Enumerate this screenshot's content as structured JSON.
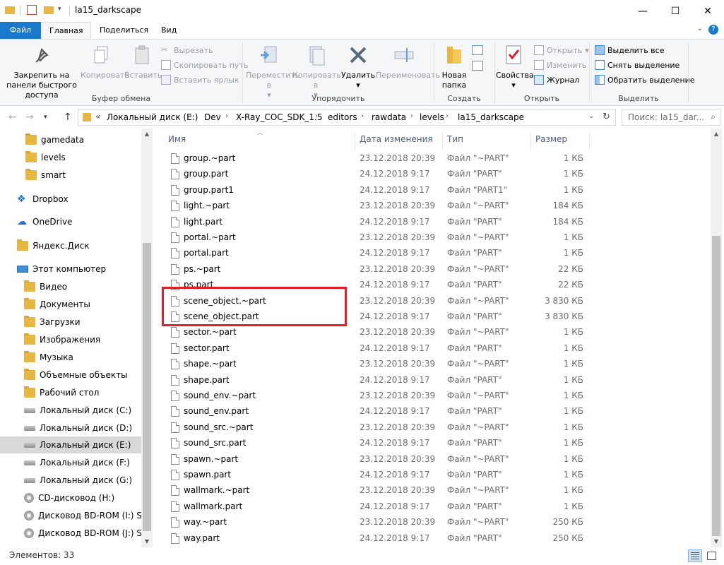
{
  "window": {
    "title": "la15_darkscape",
    "minimize_glyph": "—",
    "maximize_glyph": "☐",
    "close_glyph": "✕"
  },
  "ribbon_tabs": {
    "file": "Файл",
    "home": "Главная",
    "share": "Поделиться",
    "view": "Вид",
    "help": "?"
  },
  "ribbon": {
    "clipboard": {
      "pin": "Закрепить на панели быстрого доступа",
      "copy": "Копировать",
      "paste": "Вставить",
      "cut": "Вырезать",
      "copy_path": "Скопировать путь",
      "paste_shortcut": "Вставить ярлык",
      "group_label": "Буфер обмена"
    },
    "organize": {
      "move_to": "Переместить в",
      "copy_to": "Копировать в",
      "delete": "Удалить",
      "rename": "Переименовать",
      "group_label": "Упорядочить"
    },
    "new": {
      "new_folder": "Новая папка",
      "group_label": "Создать"
    },
    "open": {
      "properties": "Свойства",
      "open": "Открыть",
      "edit": "Изменить",
      "history": "Журнал",
      "group_label": "Открыть"
    },
    "select": {
      "select_all": "Выделить все",
      "select_none": "Снять выделение",
      "invert_selection": "Обратить выделение",
      "group_label": "Выделить"
    }
  },
  "address_bar": {
    "prefix": "«",
    "crumbs": [
      "Локальный диск (E:)",
      "Dev",
      "X-Ray_COC_SDK_1.5",
      "editors",
      "rawdata",
      "levels",
      "la15_darkscape"
    ],
    "search_placeholder": "Поиск: la15_dar..."
  },
  "nav_pane": {
    "items": [
      {
        "label": "gamedata",
        "icon": "folder-icon"
      },
      {
        "label": "levels",
        "icon": "folder-icon"
      },
      {
        "label": "smart",
        "icon": "folder-icon"
      },
      {
        "label": "Dropbox",
        "icon": "dropbox-icon"
      },
      {
        "label": "OneDrive",
        "icon": "onedrive-icon"
      },
      {
        "label": "Яндекс.Диск",
        "icon": "yandex-disk-icon"
      },
      {
        "label": "Этот компьютер",
        "icon": "computer-icon"
      },
      {
        "label": "Видео",
        "icon": "video-folder-icon"
      },
      {
        "label": "Документы",
        "icon": "documents-folder-icon"
      },
      {
        "label": "Загрузки",
        "icon": "downloads-folder-icon"
      },
      {
        "label": "Изображения",
        "icon": "pictures-folder-icon"
      },
      {
        "label": "Музыка",
        "icon": "music-folder-icon"
      },
      {
        "label": "Объемные объекты",
        "icon": "3d-objects-folder-icon"
      },
      {
        "label": "Рабочий стол",
        "icon": "desktop-folder-icon"
      },
      {
        "label": "Локальный диск (C:)",
        "icon": "drive-icon"
      },
      {
        "label": "Локальный диск (D:)",
        "icon": "drive-icon"
      },
      {
        "label": "Локальный диск (E:)",
        "icon": "drive-icon"
      },
      {
        "label": "Локальный диск (F:)",
        "icon": "drive-icon"
      },
      {
        "label": "Локальный диск (G:)",
        "icon": "drive-icon"
      },
      {
        "label": "CD-дисковод (H:)",
        "icon": "cd-drive-icon"
      },
      {
        "label": "Дисковод BD-ROM (I:) STA",
        "icon": "cd-drive-icon"
      },
      {
        "label": "Дисковод BD-ROM (J:) STA",
        "icon": "cd-drive-icon"
      }
    ]
  },
  "file_list": {
    "columns": {
      "name": "Имя",
      "date": "Дата изменения",
      "type": "Тип",
      "size": "Размер"
    },
    "rows": [
      {
        "name": "group.~part",
        "date": "23.12.2018 20:39",
        "type": "Файл \"~PART\"",
        "size": "1 КБ"
      },
      {
        "name": "group.part",
        "date": "24.12.2018 9:17",
        "type": "Файл \"PART\"",
        "size": "1 КБ"
      },
      {
        "name": "group.part1",
        "date": "24.12.2018 9:17",
        "type": "Файл \"PART1\"",
        "size": "1 КБ"
      },
      {
        "name": "light.~part",
        "date": "23.12.2018 20:39",
        "type": "Файл \"~PART\"",
        "size": "184 КБ"
      },
      {
        "name": "light.part",
        "date": "24.12.2018 9:17",
        "type": "Файл \"PART\"",
        "size": "184 КБ"
      },
      {
        "name": "portal.~part",
        "date": "23.12.2018 20:39",
        "type": "Файл \"~PART\"",
        "size": "1 КБ"
      },
      {
        "name": "portal.part",
        "date": "24.12.2018 9:17",
        "type": "Файл \"PART\"",
        "size": "1 КБ"
      },
      {
        "name": "ps.~part",
        "date": "23.12.2018 20:39",
        "type": "Файл \"~PART\"",
        "size": "22 КБ"
      },
      {
        "name": "ps.part",
        "date": "24.12.2018 9:17",
        "type": "Файл \"PART\"",
        "size": "22 КБ"
      },
      {
        "name": "scene_object.~part",
        "date": "23.12.2018 20:39",
        "type": "Файл \"~PART\"",
        "size": "3 830 КБ"
      },
      {
        "name": "scene_object.part",
        "date": "24.12.2018 9:17",
        "type": "Файл \"PART\"",
        "size": "3 830 КБ"
      },
      {
        "name": "sector.~part",
        "date": "23.12.2018 20:39",
        "type": "Файл \"~PART\"",
        "size": "1 КБ"
      },
      {
        "name": "sector.part",
        "date": "24.12.2018 9:17",
        "type": "Файл \"PART\"",
        "size": "1 КБ"
      },
      {
        "name": "shape.~part",
        "date": "23.12.2018 20:39",
        "type": "Файл \"~PART\"",
        "size": "1 КБ"
      },
      {
        "name": "shape.part",
        "date": "24.12.2018 9:17",
        "type": "Файл \"PART\"",
        "size": "1 КБ"
      },
      {
        "name": "sound_env.~part",
        "date": "23.12.2018 20:39",
        "type": "Файл \"~PART\"",
        "size": "1 КБ"
      },
      {
        "name": "sound_env.part",
        "date": "24.12.2018 9:17",
        "type": "Файл \"PART\"",
        "size": "1 КБ"
      },
      {
        "name": "sound_src.~part",
        "date": "23.12.2018 20:39",
        "type": "Файл \"~PART\"",
        "size": "1 КБ"
      },
      {
        "name": "sound_src.part",
        "date": "24.12.2018 9:17",
        "type": "Файл \"PART\"",
        "size": "1 КБ"
      },
      {
        "name": "spawn.~part",
        "date": "23.12.2018 20:39",
        "type": "Файл \"~PART\"",
        "size": "1 КБ"
      },
      {
        "name": "spawn.part",
        "date": "24.12.2018 9:17",
        "type": "Файл \"PART\"",
        "size": "1 КБ"
      },
      {
        "name": "wallmark.~part",
        "date": "23.12.2018 20:39",
        "type": "Файл \"~PART\"",
        "size": "1 КБ"
      },
      {
        "name": "wallmark.part",
        "date": "24.12.2018 9:17",
        "type": "Файл \"PART\"",
        "size": "1 КБ"
      },
      {
        "name": "way.~part",
        "date": "23.12.2018 20:39",
        "type": "Файл \"~PART\"",
        "size": "250 КБ"
      },
      {
        "name": "way.part",
        "date": "24.12.2018 9:17",
        "type": "Файл \"PART\"",
        "size": "250 КБ"
      }
    ]
  },
  "status_bar": {
    "item_count": "Элементов: 33"
  },
  "colors": {
    "accent": "#1979ca",
    "highlight_box": "#e0202a",
    "folder": "#e8b642"
  }
}
